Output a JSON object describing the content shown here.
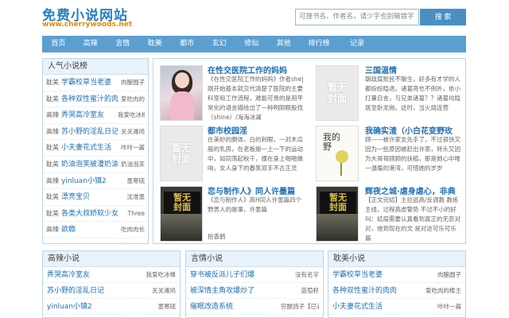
{
  "site": {
    "title": "免费小说网站",
    "url": "www.cherrywoods.net"
  },
  "search": {
    "placeholder": "可搜书名、作者名，请少字也别输错字",
    "button": "搜 索"
  },
  "nav": [
    "首页",
    "高辣",
    "言情",
    "耽美",
    "都市",
    "玄幻",
    "修仙",
    "其他",
    "排行榜",
    "记录"
  ],
  "ranking": {
    "title": "人气小说榜",
    "items": [
      {
        "cat": "耽美",
        "name": "学霸校草当老婆",
        "author": "肉酿圆子"
      },
      {
        "cat": "耽美",
        "name": "各种双性蜜汁的肉肉",
        "author": "爱吃肉的"
      },
      {
        "cat": "高辣",
        "name": "弄哭高冷室友",
        "author": "我爱吃冰棒"
      },
      {
        "cat": "高辣",
        "name": "苏小野的淫乱日记",
        "author": "关关滩鸠"
      },
      {
        "cat": "耽美",
        "name": "小夫妻花式生活",
        "author": "咔咔一酱"
      },
      {
        "cat": "耽美",
        "name": "奶油泡芙被灌奶油",
        "author": "奶油泡芙"
      },
      {
        "cat": "高辣",
        "name": "yinluan小镇2",
        "author": "墨寒砚"
      },
      {
        "cat": "耽美",
        "name": "漂亮宝贝",
        "author": "沈淮墨"
      },
      {
        "cat": "耽美",
        "name": "各类大叔娇软少女",
        "author": "Three"
      },
      {
        "cat": "高辣",
        "name": "欲瘾",
        "author": "吃肉肉长"
      }
    ]
  },
  "featured": [
    {
      "title": "在性交医院工作的妈妈",
      "desc": "《在性交医院工作的妈妈》作者she|刚开始基本就交代清楚了医院的主要科室和工作流程，难能可贵的是用平常化的语言描绘出了一种咧阴眼股找（shine）/海海冰澜"
    },
    {
      "title": "三国温情",
      "desc": "朝政腐败民不聊生，好多有才学的人都纷纷隐退。诸葛亮也不例外，依小打量自言，与兄弟诸葛？？诸葛均隐居至卧龙岗。这时，当火烧连营"
    },
    {
      "title": "都市校园淫",
      "desc": "在美妙的胴体，白的刺眼，一对木瓜般的乳房，在老板娘一上一下的运动中，如同荡起秋千，撞在身上啪啪做响，女人身下的春笑双手不古正灵"
    },
    {
      "title": "我确实渣（小白花变野玫",
      "desc": "顾——被许家女先手了，不过很快又因为一些原因被赶出许家，转头又因为大哥哥顾顾的扶植，那是她心中唯一温暖的港湾，可惜她的岁岁"
    },
    {
      "title": "恋与制作人》同人许墨篇",
      "desc": "《恋与制作人》高H同人许墨篇四个野男人的故事，许墨篇"
    },
    {
      "title": "辉夜之城·虐身虐心，非典",
      "desc": "【正文完结】主拉逃高/反调教 教练主线，过程高虐警势 不过不小的好叫：结局需要认真看到真正的无奈对对，他到现在的文 是对这可乐可乐酱"
    }
  ],
  "featured_footer": "拾香鹤",
  "sections": [
    {
      "title": "高辣小说",
      "items": [
        {
          "name": "弄哭高冷室友",
          "author": "我爱吃冰棒"
        },
        {
          "name": "苏小野的淫乱日记",
          "author": "关关滩鸠"
        },
        {
          "name": "yinluan小镇2",
          "author": "墨寒砚"
        }
      ]
    },
    {
      "title": "言情小说",
      "items": [
        {
          "name": "穿书被反派儿子们爆",
          "author": "没有名字"
        },
        {
          "name": "被深情主角攻爆炒了",
          "author": "蓝萄籽"
        },
        {
          "name": "催眠改造系统",
          "author": "穷酸鸽子【已老"
        }
      ]
    },
    {
      "title": "耽美小说",
      "items": [
        {
          "name": "学霸校草当老婆",
          "author": "肉酿圆子"
        },
        {
          "name": "各种双性蜜汁的肉肉",
          "author": "爱吃肉的楼主"
        },
        {
          "name": "小夫妻花式生活",
          "author": "咔咔一酱"
        }
      ]
    }
  ],
  "covers": {
    "empty_text_1": "暂无",
    "empty_text_2": "封面",
    "art_text_1": "我的",
    "art_text_2": "野"
  },
  "colors": {
    "brand": "#2a7fc0",
    "url": "#e68a00",
    "nav": "#5b9fd0",
    "link": "#1f6fb3"
  }
}
